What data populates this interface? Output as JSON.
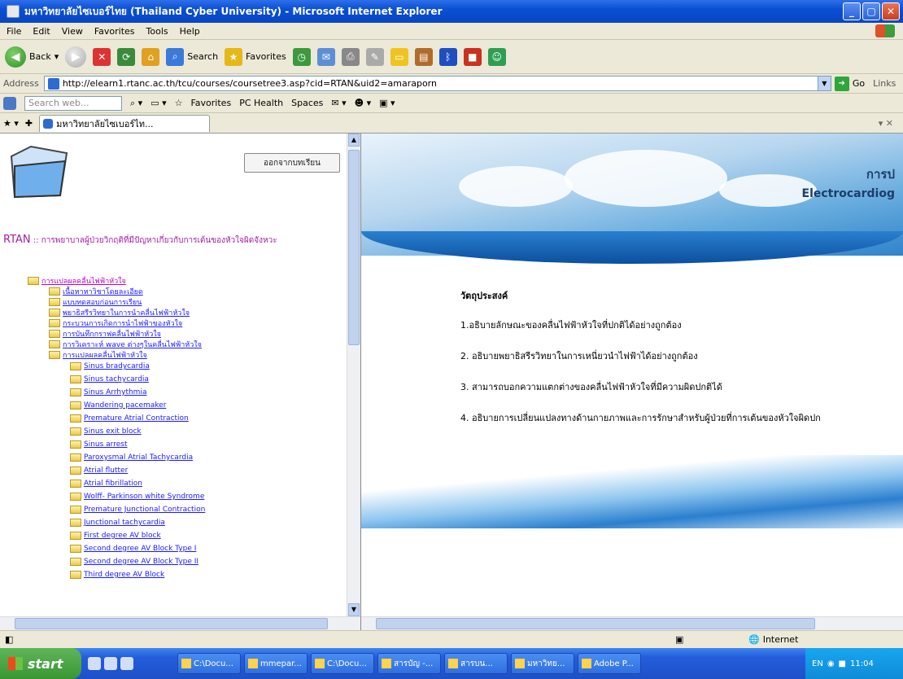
{
  "window": {
    "title": "มหาวิทยาลัยไซเบอร์ไทย (Thailand Cyber University) - Microsoft Internet Explorer",
    "controls": [
      "_",
      "▢",
      "✕"
    ]
  },
  "menu": [
    "File",
    "Edit",
    "View",
    "Favorites",
    "Tools",
    "Help"
  ],
  "toolbar": {
    "back": "Back",
    "search": "Search",
    "favorites": "Favorites"
  },
  "address": {
    "label": "Address",
    "url": "http://elearn1.rtanc.ac.th/tcu/courses/coursetree3.asp?cid=RTAN&uid2=amaraporn",
    "go": "Go",
    "links": "Links"
  },
  "linksbar": {
    "search_placeholder": "Search web...",
    "favorites": "Favorites",
    "pchealth": "PC Health",
    "spaces": "Spaces"
  },
  "tab": {
    "label": "มหาวิทยาลัยไซเบอร์ไท..."
  },
  "left": {
    "exit_button": "ออกจากบทเรียน",
    "course_prefix": "RTAN",
    "course_title": " :: การพยาบาลผู้ป่วยวิกฤติที่มีปัญหาเกี่ยวกับการเต้นของหัวใจผิดจังหวะ",
    "tree_root": "การแปลผลคลื่นไฟฟ้าหัวใจ",
    "tree_l1": [
      "เนื้อหาหาวิชาโดยละเอียด",
      "แบบทดสอบก่อนการเรียน",
      "พยาธิสรีรวิทยาในการนำคลื่นไฟฟ้าหัวใจ",
      "กระบวนการเกิดการนำไฟฟ้าของหัวใจ",
      "การบันทึกกราฟคลื่นไฟฟ้าหัวใจ",
      "การวิเคราะห์ wave ต่างๆในคลื่นไฟฟ้าหัวใจ",
      "การแปลผลคลื่นไฟฟ้าหัวใจ"
    ],
    "tree_l2": [
      "Sinus bradycardia",
      "Sinus tachycardia",
      "Sinus Arrhythmia",
      "Wandering pacemaker",
      "Premature Atrial Contraction",
      "Sinus exit block",
      "Sinus arrest",
      "Paroxysmal Atrial Tachycardia",
      "Atrial flutter",
      "Atrial fibrillation",
      "Wolff- Parkinson white Syndrome",
      "Premature Junctional Contraction",
      "Junctional tachycardia",
      "First degree AV block",
      "Second degree AV Block Type I",
      "Second degree AV Block Type II",
      "Third degree AV Block"
    ]
  },
  "right": {
    "banner_title": "การป",
    "banner_subtitle": "Electrocardiog",
    "objectives_title": "วัตถุประสงค์",
    "objectives": [
      "1.อธิบายลักษณะของคลื่นไฟฟ้าหัวใจที่ปกติได้อย่างถูกต้อง",
      "2. อธิบายพยาธิสรีรวิทยาในการเหนี่ยวนำไฟฟ้าได้อย่างถูกต้อง",
      "3. สามารถบอกความแตกต่างของคลื่นไฟฟ้าหัวใจที่มีความผิดปกติได้",
      "4. อธิบายการเปลี่ยนแปลงทางด้านกายภาพและการรักษาสำหรับผู้ป่วยที่การเต้นของหัวใจผิดปก"
    ]
  },
  "status": {
    "zone": "Internet"
  },
  "taskbar": {
    "start": "start",
    "tasks": [
      "C:\\Docu...",
      "mmepar...",
      "C:\\Docu...",
      "สารบัญ -...",
      "สารบน...",
      "มหาวิทย...",
      "Adobe P..."
    ],
    "lang": "EN",
    "clock": "11:04"
  }
}
